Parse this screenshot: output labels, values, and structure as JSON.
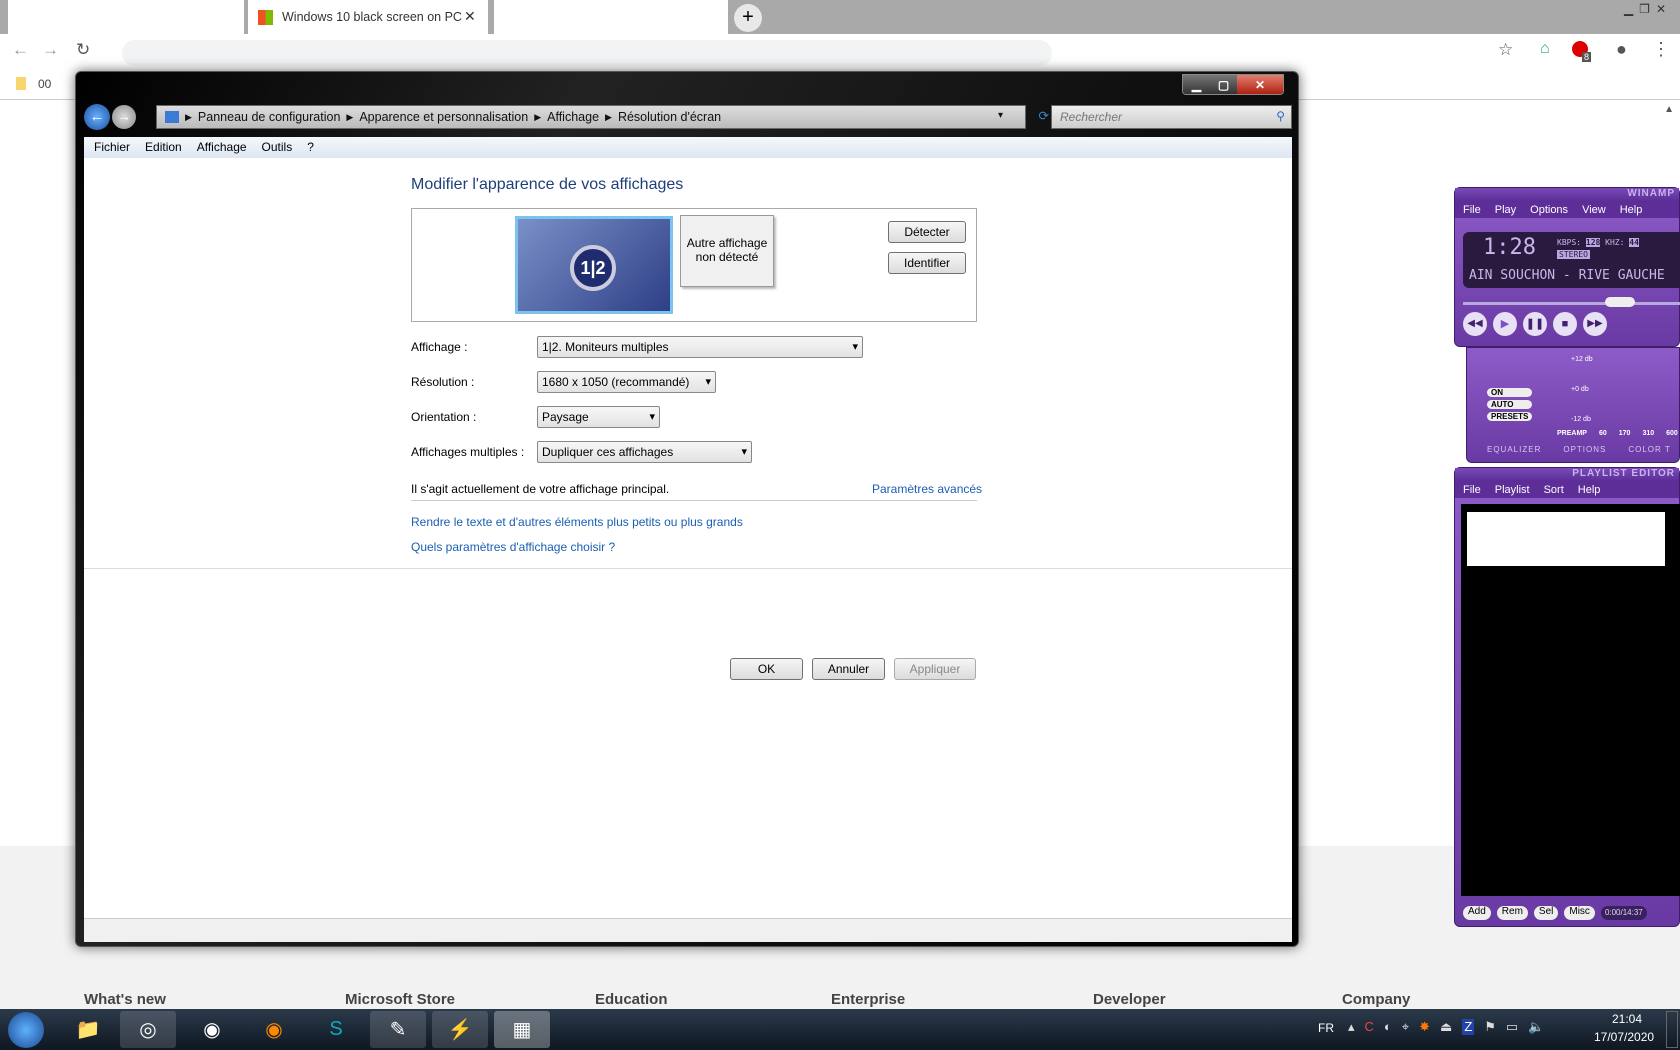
{
  "browser": {
    "active_tab_title": "Windows 10 black screen on PC",
    "new_tab_icon": "plus-icon",
    "bookmark": "00",
    "extension_badge": "8"
  },
  "dialog": {
    "breadcrumb": [
      "Panneau de configuration",
      "Apparence et personnalisation",
      "Affichage",
      "Résolution d'écran"
    ],
    "search_placeholder": "Rechercher",
    "menu": [
      "Fichier",
      "Edition",
      "Affichage",
      "Outils",
      "?"
    ],
    "heading": "Modifier l'apparence de vos affichages",
    "monitor_label": "1|2",
    "other_display": "Autre affichage non détecté",
    "detect": "Détecter",
    "identify": "Identifier",
    "fields": [
      {
        "label": "Affichage :",
        "value": "1|2. Moniteurs multiples"
      },
      {
        "label": "Résolution :",
        "value": "1680 x 1050 (recommandé)"
      },
      {
        "label": "Orientation :",
        "value": "Paysage"
      },
      {
        "label": "Affichages multiples :",
        "value": "Dupliquer ces affichages"
      }
    ],
    "primary_note": "Il s'agit actuellement de votre affichage principal.",
    "advanced": "Paramètres avancés",
    "link1": "Rendre le texte et d'autres éléments plus petits ou plus grands",
    "link2": "Quels paramètres d'affichage choisir ?",
    "ok": "OK",
    "cancel": "Annuler",
    "apply": "Appliquer"
  },
  "footer": [
    "What's new",
    "Microsoft Store",
    "Education",
    "Enterprise",
    "Developer",
    "Company"
  ],
  "winamp": {
    "title": "WINAMP",
    "menu": [
      "File",
      "Play",
      "Options",
      "View",
      "Help"
    ],
    "time": "1:28",
    "kbps": "128",
    "khz": "44",
    "stereo": "STEREO",
    "scroll": "AIN SOUCHON - RIVE GAUCHE",
    "eq_title": "EQUALIZER",
    "eq_tabs": [
      "EQUALIZER",
      "OPTIONS",
      "COLOR T"
    ],
    "eq_buttons": [
      "ON",
      "AUTO",
      "PRESETS"
    ],
    "eq_db": [
      "+12 db",
      "+0 db",
      "-12 db"
    ],
    "eq_bands": [
      "PREAMP",
      "60",
      "170",
      "310",
      "600"
    ],
    "playlist_title": "PLAYLIST EDITOR",
    "playlist_menu": [
      "File",
      "Playlist",
      "Sort",
      "Help"
    ],
    "playlist_buttons": [
      "Add",
      "Rem",
      "Sel",
      "Misc"
    ],
    "playlist_time": "0:00/14:37"
  },
  "tray": {
    "lang": "FR",
    "time": "21:04",
    "date": "17/07/2020"
  }
}
